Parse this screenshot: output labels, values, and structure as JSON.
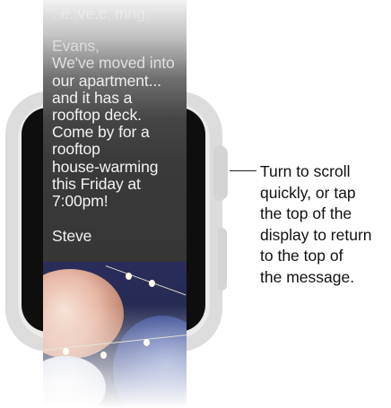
{
  "message": {
    "header_fragment": "..e..ve.c..mng.",
    "greeting": "Evans,",
    "body_lines": [
      "We've moved into",
      "our apartment...",
      "and it has a",
      "rooftop deck.",
      "Come by for a",
      "rooftop",
      "house-warming",
      "this Friday at",
      "7:00pm!"
    ],
    "signature": "Steve"
  },
  "callout": {
    "lines": [
      "Turn to scroll",
      "quickly, or tap",
      "the top of the",
      "display to return",
      "to the top of",
      "the message."
    ]
  },
  "colors": {
    "watch_body": "#dcdcdc",
    "screen": "#0e0e0e",
    "message_background": "#363636",
    "message_text": "#f2f2f2",
    "caption_text": "#111111"
  }
}
